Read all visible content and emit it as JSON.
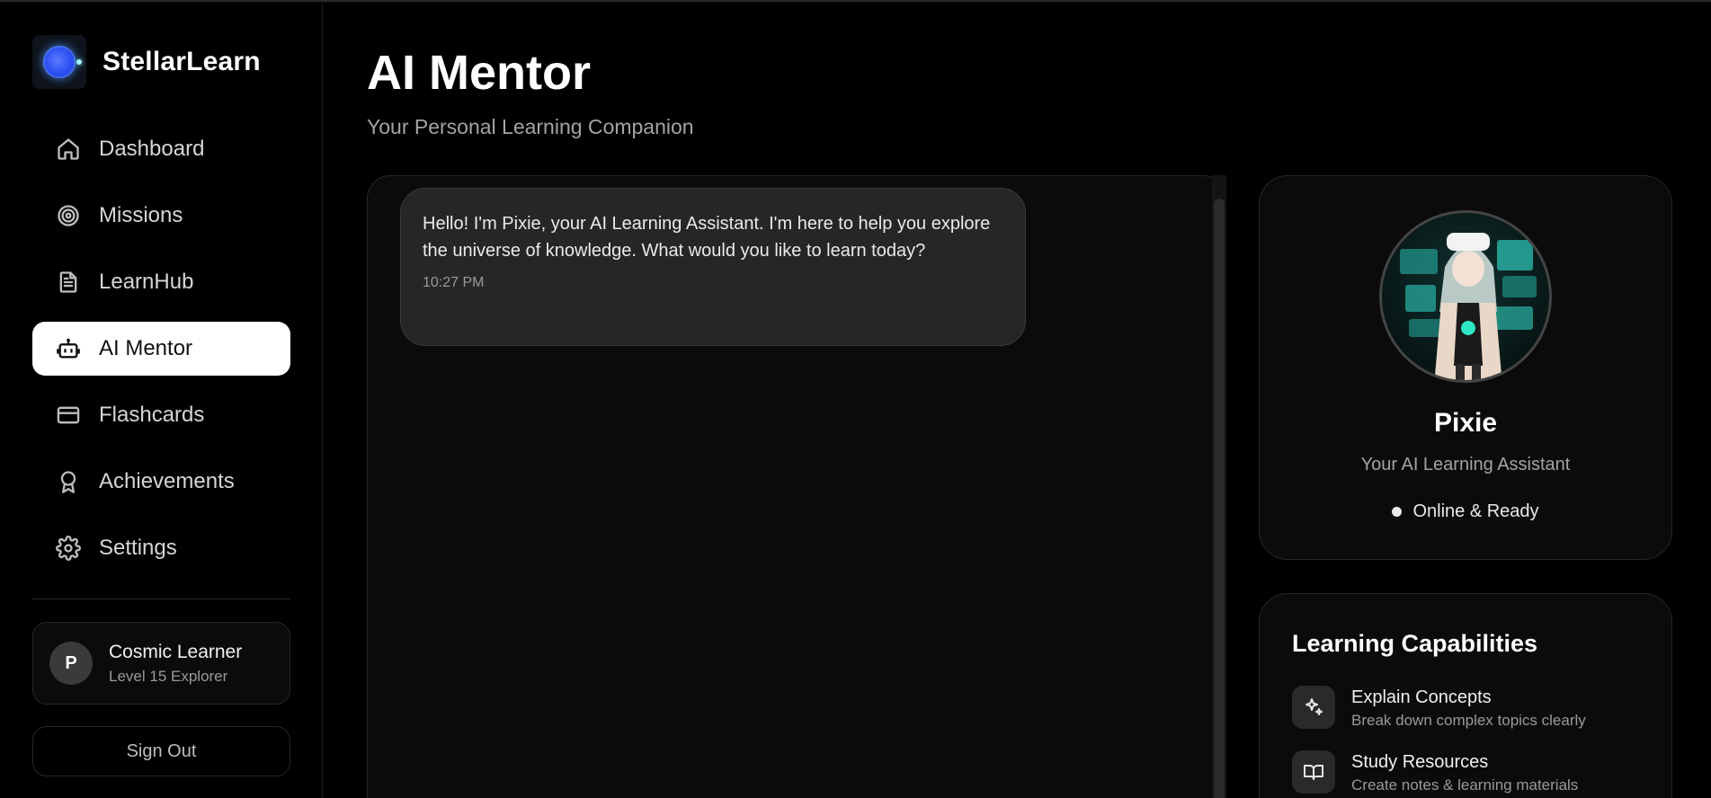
{
  "brand": {
    "name": "StellarLearn",
    "logo_icon": "glowing-orb-icon"
  },
  "sidebar": {
    "items": [
      {
        "label": "Dashboard",
        "icon": "home-icon",
        "active": false
      },
      {
        "label": "Missions",
        "icon": "target-icon",
        "active": false
      },
      {
        "label": "LearnHub",
        "icon": "document-icon",
        "active": false
      },
      {
        "label": "AI Mentor",
        "icon": "robot-icon",
        "active": true
      },
      {
        "label": "Flashcards",
        "icon": "card-icon",
        "active": false
      },
      {
        "label": "Achievements",
        "icon": "award-icon",
        "active": false
      },
      {
        "label": "Settings",
        "icon": "gear-icon",
        "active": false
      }
    ],
    "user": {
      "initial": "P",
      "name": "Cosmic Learner",
      "level": "Level 15 Explorer"
    },
    "sign_out_label": "Sign Out"
  },
  "main": {
    "title": "AI Mentor",
    "subtitle": "Your Personal Learning Companion"
  },
  "chat": {
    "messages": [
      {
        "sender": "assistant",
        "text": "Hello! I'm Pixie, your AI Learning Assistant. I'm here to help you explore the universe of knowledge. What would you like to learn today?",
        "time": "10:27 PM"
      }
    ]
  },
  "profile": {
    "name": "Pixie",
    "role": "Your AI Learning Assistant",
    "status": "Online & Ready"
  },
  "capabilities": {
    "title": "Learning Capabilities",
    "items": [
      {
        "name": "Explain Concepts",
        "desc": "Break down complex topics clearly",
        "icon": "sparkles-icon"
      },
      {
        "name": "Study Resources",
        "desc": "Create notes & learning materials",
        "icon": "book-open-icon"
      }
    ]
  },
  "colors": {
    "background": "#000000",
    "panel": "#0b0b0b",
    "bubble": "#262626",
    "active_nav": "#ffffff"
  }
}
